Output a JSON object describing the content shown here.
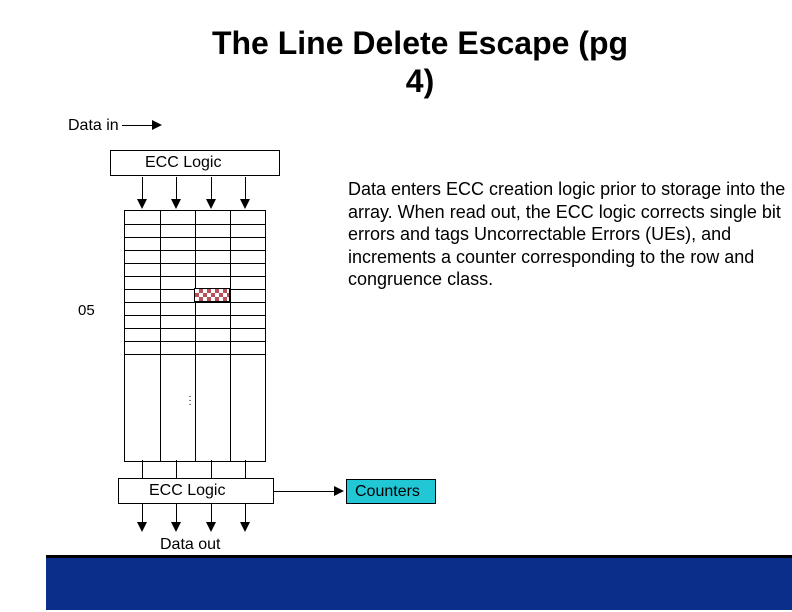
{
  "title": "The Line Delete Escape (pg 4)",
  "labels": {
    "data_in": "Data in",
    "ecc_top": "ECC Logic",
    "ecc_bottom": "ECC Logic",
    "data_out": "Data out",
    "row_05": "05",
    "counters": "Counters"
  },
  "body": "Data enters ECC creation logic prior to storage into the array.  When read out, the ECC logic corrects single bit errors and tags Uncorrectable Errors (UEs), and increments a counter corresponding to the row and congruence class."
}
